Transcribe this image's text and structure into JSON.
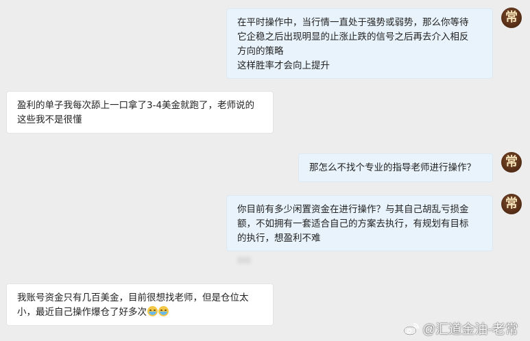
{
  "contact": {
    "avatar_char": "常"
  },
  "messages": [
    {
      "sender": "self",
      "lines": [
        "在平时操作中，当行情一直处于强势或弱势，那么你等待",
        "它企稳之后出现明显的止涨止跌的信号之后再去介入相反",
        "方向的策略",
        "这样胜率才会向上提升"
      ]
    },
    {
      "sender": "other",
      "lines": [
        "盈利的单子我每次舔上一口拿了3-4美金就跑了，老师说的",
        "这些我不是很懂"
      ]
    },
    {
      "sender": "self",
      "lines": [
        "那怎么不找个专业的指导老师进行操作？"
      ]
    },
    {
      "sender": "self",
      "lines": [
        "你目前有多少闲置资金在进行操作？与其自己胡乱亏损金",
        "额，不如拥有一套适合自己的方案去执行，有规划有目标",
        "的执行，想盈利不难"
      ]
    },
    {
      "sender": "other",
      "lines": [
        "我账号资金只有几百美金，目前很想找老师，但是仓位太",
        "小，最近自己操作爆仓了好多次"
      ],
      "emoji": [
        "loudly-crying-face",
        "loudly-crying-face"
      ]
    }
  ],
  "watermark": {
    "text": "@汇道金油-老常",
    "icon": "weibo-logo"
  }
}
